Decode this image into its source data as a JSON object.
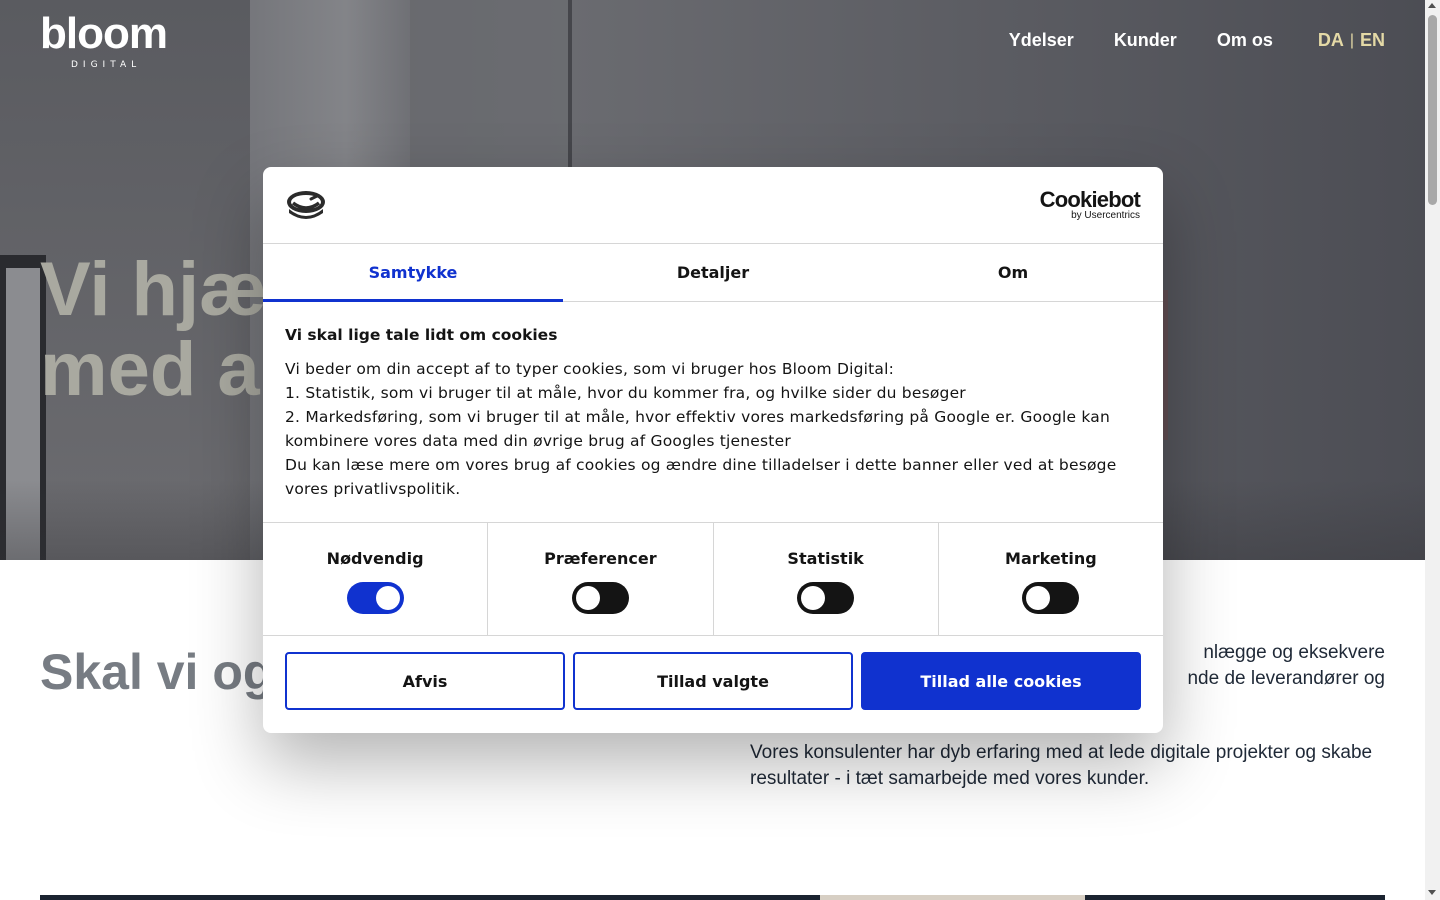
{
  "site": {
    "logo": {
      "word": "bloom",
      "sub": "DIGITAL"
    },
    "nav": [
      "Ydelser",
      "Kunder",
      "Om os"
    ],
    "lang": {
      "da": "DA",
      "separator": "|",
      "en": "EN",
      "active_color": "#e4d9a6"
    },
    "hero": {
      "line1": "Vi hjæ",
      "line2": "med a"
    },
    "section": {
      "title": "Skal vi og",
      "para1_line1": "nlægge og eksekvere",
      "para1_line2": "nde de leverandører og",
      "para2": "Vores konsulenter har dyb erfaring med at lede digitale projekter og skabe resultater - i tæt samarbejde med vores kunder."
    }
  },
  "cookie_dialog": {
    "brand": {
      "word": "Cookiebot",
      "sub": "by Usercentrics"
    },
    "tabs": [
      {
        "label": "Samtykke",
        "active": true
      },
      {
        "label": "Detaljer",
        "active": false
      },
      {
        "label": "Om",
        "active": false
      }
    ],
    "title": "Vi skal lige tale lidt om cookies",
    "lines": [
      "Vi beder om din accept af to typer cookies, som vi bruger hos Bloom Digital:",
      "1. Statistik, som vi bruger til at måle, hvor du kommer fra, og hvilke sider du besøger",
      "2. Markedsføring, som vi bruger til at måle, hvor effektiv vores markedsføring på Google er. Google kan",
      "kombinere vores data med din øvrige brug af Googles tjenester",
      "Du kan læse mere om vores brug af cookies og ændre dine tilladelser i dette banner eller ved at besøge",
      "vores privatlivspolitik."
    ],
    "toggles": [
      {
        "label": "Nødvendig",
        "on": true
      },
      {
        "label": "Præferencer",
        "on": false
      },
      {
        "label": "Statistik",
        "on": false
      },
      {
        "label": "Marketing",
        "on": false
      }
    ],
    "buttons": {
      "reject": "Afvis",
      "allow_selected": "Tillad valgte",
      "allow_all": "Tillad alle cookies"
    },
    "accent_color": "#1032cf"
  }
}
